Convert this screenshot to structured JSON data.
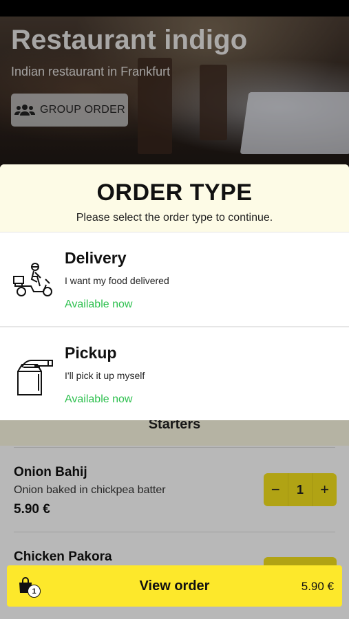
{
  "hero": {
    "title": "Restaurant indigo",
    "subtitle": "Indian restaurant in Frankfurt",
    "group_order_label": "GROUP ORDER",
    "group_icon": "group-icon"
  },
  "order_type": {
    "title": "ORDER TYPE",
    "subtitle": "Please select the order type to continue.",
    "options": [
      {
        "title": "Delivery",
        "description": "I want my food delivered",
        "availability": "Available now",
        "icon": "scooter-delivery-icon"
      },
      {
        "title": "Pickup",
        "description": "I'll pick it up myself",
        "availability": "Available now",
        "icon": "pickup-bag-icon"
      }
    ]
  },
  "menu": {
    "section_title": "Starters",
    "items": [
      {
        "name": "Onion Bahij",
        "description": "Onion baked in chickpea batter",
        "price": "5.90 €",
        "quantity": "1"
      },
      {
        "name": "Chicken Pakora"
      }
    ]
  },
  "view_order": {
    "label": "View order",
    "price": "5.90 €",
    "badge_count": "1"
  },
  "colors": {
    "accent_yellow": "#fde82b",
    "available_green": "#2ec04f",
    "sheet_header_bg": "#fdfbe6"
  }
}
